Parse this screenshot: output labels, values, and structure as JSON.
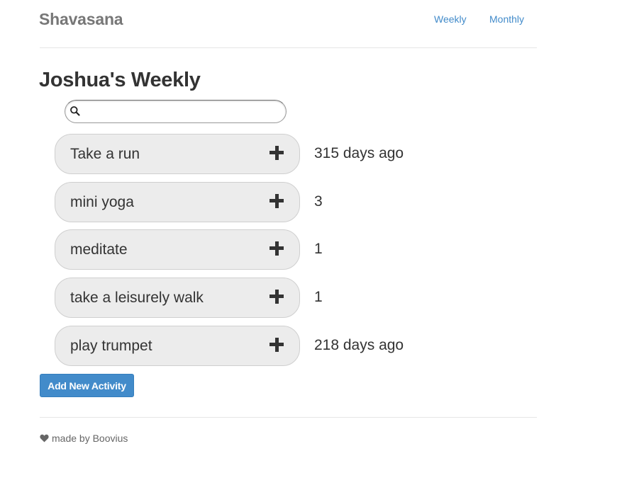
{
  "header": {
    "brand": "Shavasana",
    "nav": [
      {
        "label": "Weekly"
      },
      {
        "label": "Monthly"
      }
    ]
  },
  "main": {
    "title": "Joshua's Weekly",
    "search": {
      "value": "",
      "placeholder": "",
      "icon": "search-icon"
    },
    "activities": [
      {
        "name": "Take a run",
        "status": "315 days ago",
        "icon": "plus-icon"
      },
      {
        "name": "mini yoga",
        "status": "3",
        "icon": "plus-icon"
      },
      {
        "name": "meditate",
        "status": "1",
        "icon": "plus-icon"
      },
      {
        "name": "take a leisurely walk",
        "status": "1",
        "icon": "plus-icon"
      },
      {
        "name": "play trumpet",
        "status": "218 days ago",
        "icon": "plus-icon"
      }
    ],
    "add_button_label": "Add New Activity"
  },
  "footer": {
    "icon": "heart-icon",
    "text": "made by Boovius"
  },
  "colors": {
    "link": "#428bca",
    "button": "#428bca",
    "pill_background": "#ececec",
    "brand_text": "#777777"
  }
}
